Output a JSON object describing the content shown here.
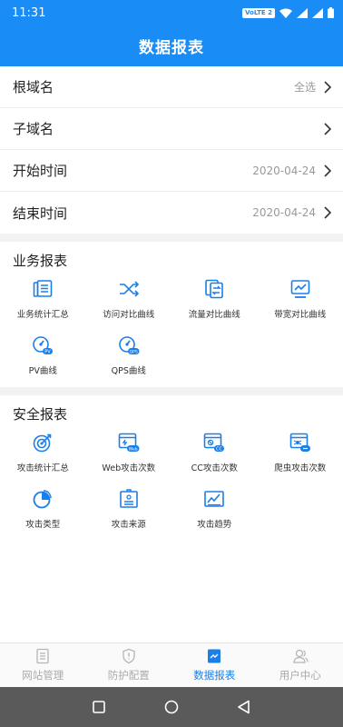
{
  "status_bar": {
    "time": "11:31",
    "network_badge": "VoLTE 2"
  },
  "header": {
    "title": "数据报表"
  },
  "filters": [
    {
      "label": "根域名",
      "value": "全选"
    },
    {
      "label": "子域名",
      "value": ""
    },
    {
      "label": "开始时间",
      "value": "2020-04-24"
    },
    {
      "label": "结束时间",
      "value": "2020-04-24"
    }
  ],
  "business": {
    "title": "业务报表",
    "items": [
      {
        "label": "业务统计汇总",
        "icon": "report-summary-icon"
      },
      {
        "label": "访问对比曲线",
        "icon": "shuffle-compare-icon"
      },
      {
        "label": "流量对比曲线",
        "icon": "traffic-compare-icon"
      },
      {
        "label": "带宽对比曲线",
        "icon": "bandwidth-monitor-icon"
      },
      {
        "label": "PV曲线",
        "icon": "pv-gauge-icon"
      },
      {
        "label": "QPS曲线",
        "icon": "qps-gauge-icon"
      }
    ]
  },
  "security": {
    "title": "安全报表",
    "items": [
      {
        "label": "攻击统计汇总",
        "icon": "target-icon"
      },
      {
        "label": "Web攻击次数",
        "icon": "web-attack-icon"
      },
      {
        "label": "CC攻击次数",
        "icon": "cc-attack-icon"
      },
      {
        "label": "爬虫攻击次数",
        "icon": "crawler-attack-icon"
      },
      {
        "label": "攻击类型",
        "icon": "pie-chart-icon"
      },
      {
        "label": "攻击来源",
        "icon": "source-building-icon"
      },
      {
        "label": "攻击趋势",
        "icon": "trend-chart-icon"
      }
    ]
  },
  "tabbar": {
    "items": [
      {
        "label": "网站管理",
        "icon": "document-icon"
      },
      {
        "label": "防护配置",
        "icon": "shield-icon"
      },
      {
        "label": "数据报表",
        "icon": "chart-icon",
        "active": true
      },
      {
        "label": "用户中心",
        "icon": "user-icon"
      }
    ]
  },
  "colors": {
    "primary": "#1a8cf5",
    "icon_blue": "#1a7fe8",
    "tab_inactive": "#aaaaaa",
    "nav_bar": "#5a5a5a"
  }
}
